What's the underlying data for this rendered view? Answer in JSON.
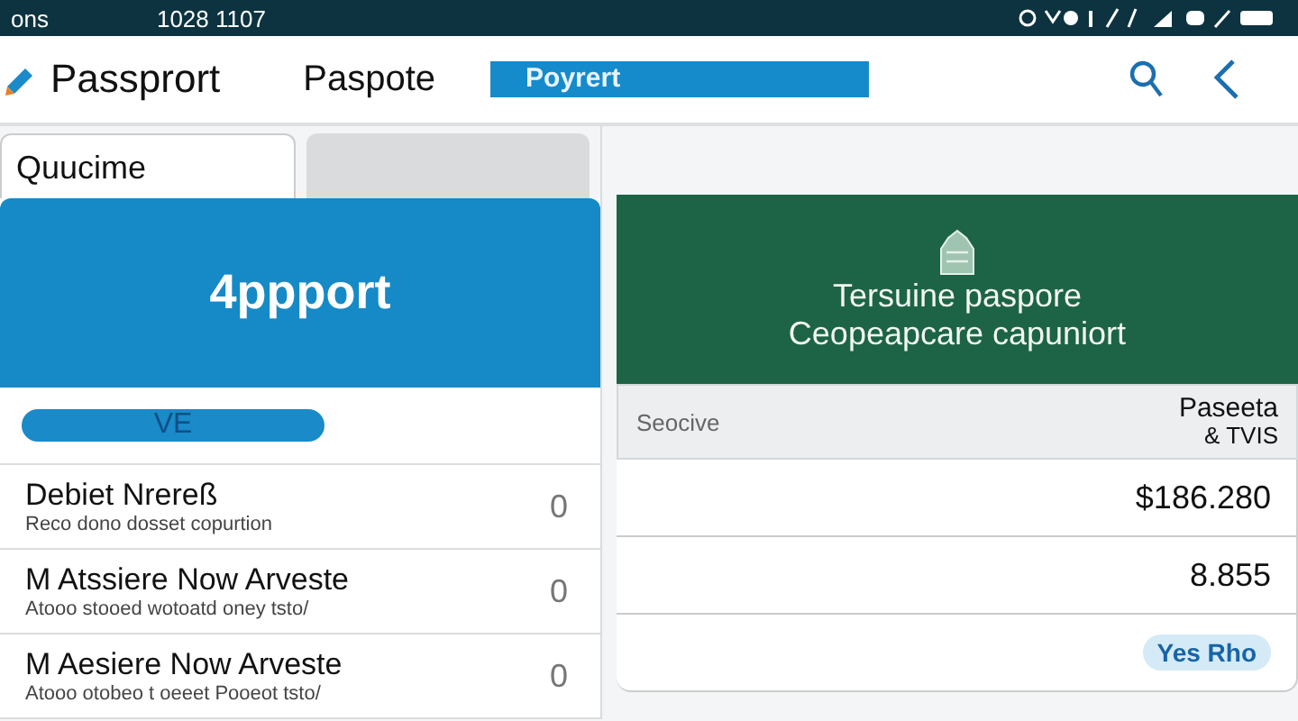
{
  "status_bar": {
    "left": "ons",
    "time": "1028 1107"
  },
  "header": {
    "title": "Passprort",
    "nav_item": "Paspote",
    "search": {
      "value": "Poyrert"
    }
  },
  "tabs": [
    {
      "label": "Quucime",
      "selected": true
    },
    {
      "selected": false
    }
  ],
  "left_card": {
    "title": "4ppport"
  },
  "filter_pill": "VE",
  "list": [
    {
      "title": "Debiet Nrereß",
      "subtitle": "Reco dono dosset copurtion",
      "count": "0"
    },
    {
      "title": "M Atssiere Now Arveste",
      "subtitle": "Atooo stooed wotoatd oney tsto/",
      "count": "0"
    },
    {
      "title": "M Aesiere Now Arveste",
      "subtitle": "Atooo otobeo t oeeet Pooeot tsto/",
      "count": "0"
    }
  ],
  "right_card": {
    "lines": [
      "Tersuine paspore",
      "Ceopeapcare capuniort"
    ]
  },
  "summary": {
    "label": "Seocive",
    "value_lines": [
      "Paseeta",
      "& TVIS"
    ]
  },
  "amounts": [
    {
      "kind": "amount",
      "text": "$186.280"
    },
    {
      "kind": "amount",
      "text": "8.855"
    },
    {
      "kind": "badge",
      "text": "Yes Rho"
    }
  ]
}
